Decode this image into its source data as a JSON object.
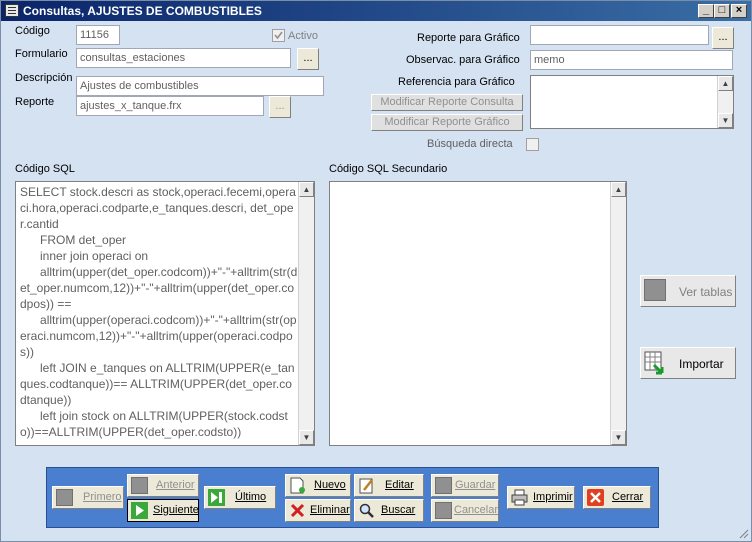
{
  "window": {
    "title": "Consultas, AJUSTES DE COMBUSTIBLES",
    "min_label": "_",
    "max_label": "□",
    "close_label": "×"
  },
  "form": {
    "codigo_label": "Código",
    "codigo_value": "11156",
    "activo_label": "Activo",
    "formulario_label": "Formulario",
    "formulario_value": "consultas_estaciones",
    "descripcion_label": "Descripción",
    "descripcion_value": "Ajustes de combustibles",
    "reporte_label": "Reporte",
    "reporte_value": "ajustes_x_tanque.frx",
    "reporte_grafico_label": "Reporte para  Gráfico",
    "reporte_grafico_value": "",
    "observac_label": "Observac. para Gráfico",
    "observac_value": "memo",
    "referencia_label": "Referencia  para  Gráfico",
    "modificar_consulta_label": "Modificar Reporte Consulta",
    "modificar_grafico_label": "Modificar Reporte Gráfico",
    "busqueda_label": "Búsqueda directa",
    "dots_label": "..."
  },
  "sql": {
    "label": "Código SQL",
    "text": "SELECT stock.descri as stock,operaci.fecemi,operaci.hora,operaci.codparte,e_tanques.descri, det_oper.cantid\n      FROM det_oper\n      inner join operaci on\n      alltrim(upper(det_oper.codcom))+\"-\"+alltrim(str(det_oper.numcom,12))+\"-\"+alltrim(upper(det_oper.codpos)) ==\n      alltrim(upper(operaci.codcom))+\"-\"+alltrim(str(operaci.numcom,12))+\"-\"+alltrim(upper(operaci.codpos))\n      left JOIN e_tanques on ALLTRIM(UPPER(e_tanques.codtanque))== ALLTRIM(UPPER(det_oper.codtanque))\n      left join stock on ALLTRIM(UPPER(stock.codsto))==ALLTRIM(UPPER(det_oper.codsto))",
    "secondary_label": "Código SQL Secundario",
    "secondary_text": ""
  },
  "side": {
    "ver_tablas": "Ver tablas",
    "importar": "Importar"
  },
  "nav": {
    "primero": "Primero",
    "anterior": "Anterior",
    "siguiente": "Siguiente",
    "ultimo": "Último",
    "nuevo": "Nuevo",
    "eliminar": "Eliminar",
    "editar": "Editar",
    "buscar": "Buscar",
    "guardar": "Guardar",
    "cancelar": "Cancelar",
    "imprimir": "Imprimir",
    "cerrar": "Cerrar"
  },
  "colors": {
    "background": "#d4e2f2",
    "nav_panel": "#4a7fd0",
    "title_bar": "#0a246a"
  }
}
